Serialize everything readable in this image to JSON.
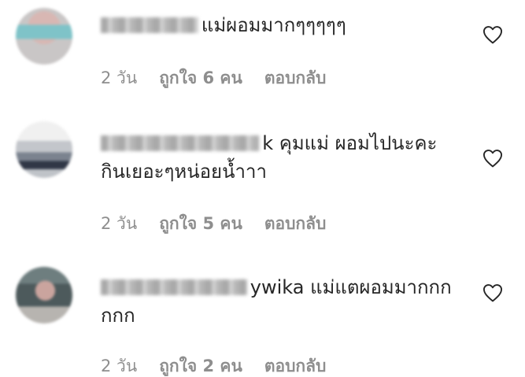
{
  "comments": [
    {
      "username": "xxxxxxxx",
      "text": "แม่ผอมมากๆๆๆๆๆ",
      "time": "2 วัน",
      "likes": "ถูกใจ 6 คน",
      "reply": "ตอบกลับ"
    },
    {
      "username": "xxxxxxxxxxxxx",
      "text": "k คุมแม่ ผอมไปนะคะ กินเยอะๆหน่อยน้ำาา",
      "time": "2 วัน",
      "likes": "ถูกใจ 5 คน",
      "reply": "ตอบกลับ"
    },
    {
      "username": "xxxxxxxxxxxx",
      "text": "ywika แม่แตผอมมากกกกกก",
      "time": "2 วัน",
      "likes": "ถูกใจ 2 คน",
      "reply": "ตอบกลับ"
    }
  ],
  "icons": {
    "avatar": "avatar",
    "like": "heart-outline-icon"
  },
  "colors": {
    "text": "#262626",
    "meta": "#8e8e8e"
  }
}
